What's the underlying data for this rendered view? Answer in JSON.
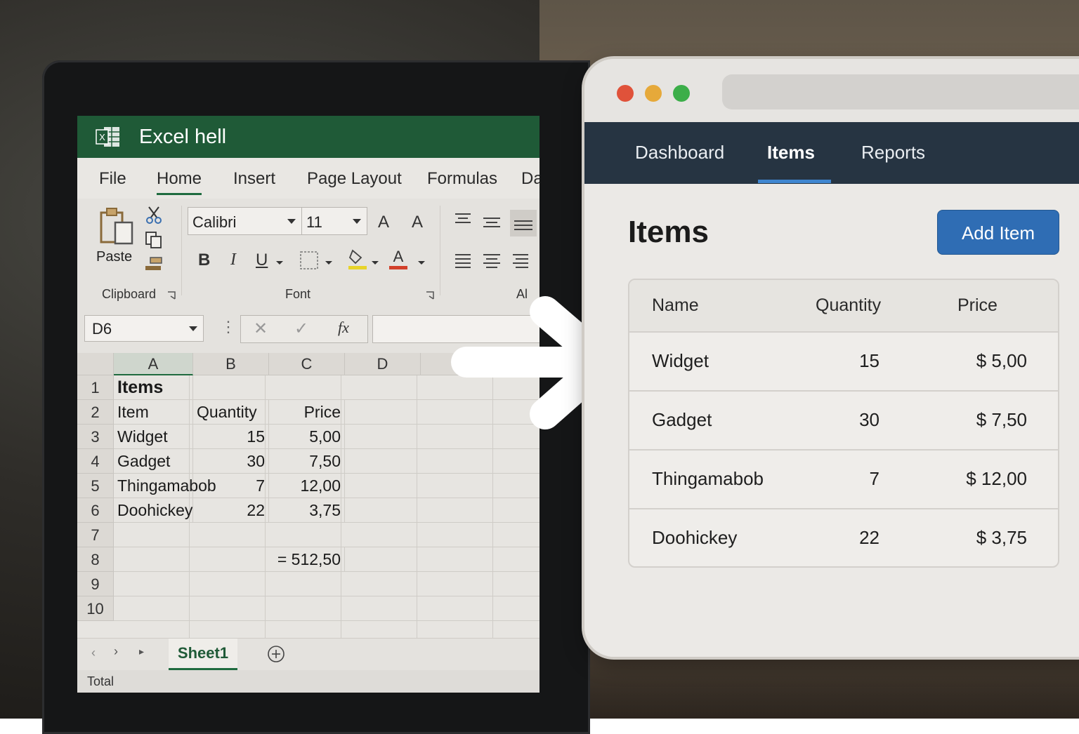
{
  "excel": {
    "title": "Excel hell",
    "tabs": [
      "File",
      "Home",
      "Insert",
      "Page Layout",
      "Formulas",
      "Da"
    ],
    "active_tab": "Home",
    "ribbon": {
      "paste_label": "Paste",
      "clipboard_label": "Clipboard",
      "font_name": "Calibri",
      "font_size": "11",
      "font_label": "Font",
      "align_label": "Al",
      "bold": "B",
      "italic": "I",
      "underline": "U",
      "grow_font": "A",
      "shrink_font": "A"
    },
    "name_box": "D6",
    "fx_label": "fx",
    "columns": [
      "A",
      "B",
      "C",
      "D"
    ],
    "rows": [
      "1",
      "2",
      "3",
      "4",
      "5",
      "6",
      "7",
      "8",
      "9",
      "10"
    ],
    "cells": {
      "a1": "Items",
      "a2": "Item",
      "b2": "Quantity",
      "c2": "Price",
      "a3": "Widget",
      "b3": "15",
      "c3": "5,00",
      "a4": "Gadget",
      "b4": "30",
      "c4": "7,50",
      "a5": "Thingamabob",
      "b5": "7",
      "c5": "12,00",
      "a6": "Doohickey",
      "b6": "22",
      "c6": "3,75",
      "c8": "= 512,50"
    },
    "sheet_tab": "Sheet1",
    "status_text": "Total"
  },
  "app": {
    "nav": [
      "Dashboard",
      "Items",
      "Reports"
    ],
    "active_nav": "Items",
    "page_title": "Items",
    "add_button": "Add Item",
    "table": {
      "headers": [
        "Name",
        "Quantity",
        "Price"
      ],
      "rows": [
        {
          "name": "Widget",
          "quantity": "15",
          "price": "$ 5,00"
        },
        {
          "name": "Gadget",
          "quantity": "30",
          "price": "$ 7,50"
        },
        {
          "name": "Thingamabob",
          "quantity": "7",
          "price": "$ 12,00"
        },
        {
          "name": "Doohickey",
          "quantity": "22",
          "price": "$ 3,75"
        }
      ]
    },
    "colors": {
      "nav_bg": "#263442",
      "accent": "#2f6db4",
      "excel_green": "#1f5a37",
      "traffic_red": "#e0523a",
      "traffic_yellow": "#e6a93a",
      "traffic_green": "#3cae49"
    }
  }
}
